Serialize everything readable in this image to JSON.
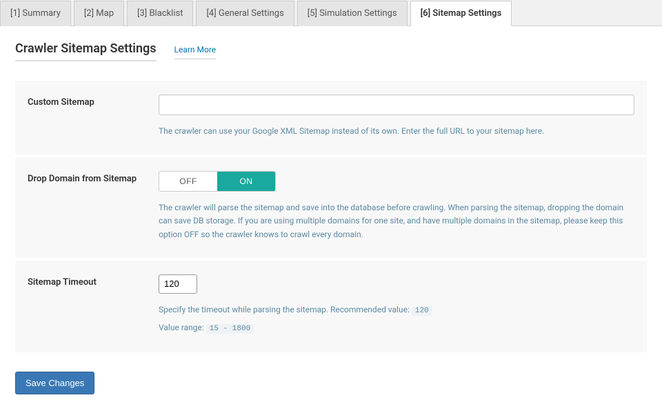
{
  "tabs": [
    {
      "label": "[1] Summary"
    },
    {
      "label": "[2] Map"
    },
    {
      "label": "[3] Blacklist"
    },
    {
      "label": "[4] General Settings"
    },
    {
      "label": "[5] Simulation Settings"
    },
    {
      "label": "[6] Sitemap Settings"
    }
  ],
  "active_tab_index": 5,
  "page": {
    "title": "Crawler Sitemap Settings",
    "learn_more": "Learn More"
  },
  "settings": {
    "custom_sitemap": {
      "label": "Custom Sitemap",
      "value": "",
      "help": "The crawler can use your Google XML Sitemap instead of its own. Enter the full URL to your sitemap here."
    },
    "drop_domain": {
      "label": "Drop Domain from Sitemap",
      "off_label": "OFF",
      "on_label": "ON",
      "value": "on",
      "help": "The crawler will parse the sitemap and save into the database before crawling. When parsing the sitemap, dropping the domain can save DB storage. If you are using multiple domains for one site, and have multiple domains in the sitemap, please keep this option OFF so the crawler knows to crawl every domain."
    },
    "sitemap_timeout": {
      "label": "Sitemap Timeout",
      "value": "120",
      "help_prefix": "Specify the timeout while parsing the sitemap. Recommended value: ",
      "recommended": "120",
      "range_prefix": "Value range: ",
      "range_min": "15",
      "range_sep": " - ",
      "range_max": "1800"
    }
  },
  "buttons": {
    "save": "Save Changes"
  }
}
